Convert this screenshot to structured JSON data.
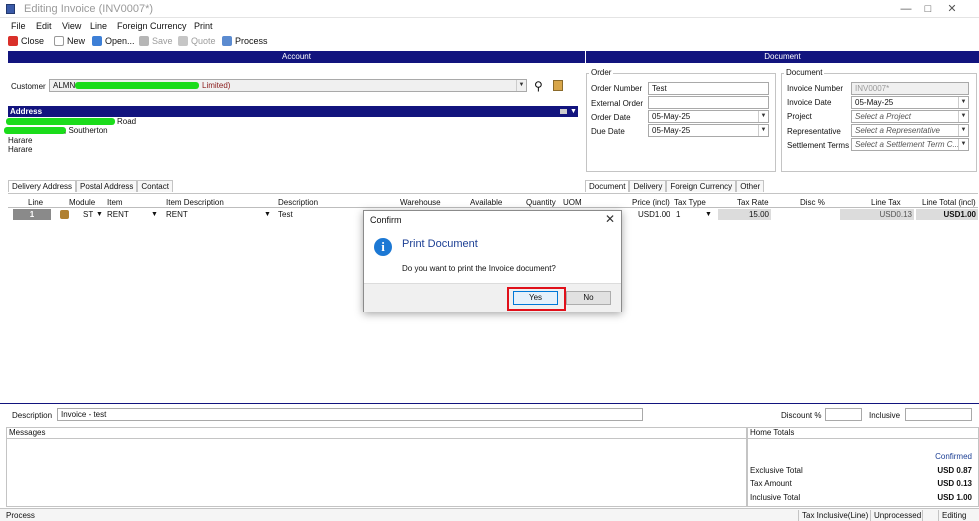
{
  "window": {
    "title": "Editing Invoice (INV0007*)"
  },
  "menu": [
    "File",
    "Edit",
    "View",
    "Line",
    "Foreign Currency",
    "Print"
  ],
  "toolbar": {
    "close": "Close",
    "new": "New",
    "open": "Open...",
    "save": "Save",
    "quote": "Quote",
    "process": "Process"
  },
  "sections": {
    "account": "Account",
    "document": "Document"
  },
  "customer": {
    "label": "Customer",
    "code": "ALMN",
    "name_suffix": "Limited)"
  },
  "address": {
    "title": "Address",
    "line1_suffix": "Road",
    "line2_suffix": ", Southerton",
    "line3": "Harare",
    "line4": "Harare"
  },
  "address_tabs": [
    "Delivery Address",
    "Postal Address",
    "Contact"
  ],
  "order": {
    "title": "Order",
    "order_number_label": "Order Number",
    "order_number": "Test",
    "external_order_label": "External Order",
    "external_order": "",
    "order_date_label": "Order Date",
    "order_date": "05-May-25",
    "due_date_label": "Due Date",
    "due_date": "05-May-25"
  },
  "document": {
    "title": "Document",
    "invoice_number_label": "Invoice Number",
    "invoice_number": "INV0007*",
    "invoice_date_label": "Invoice Date",
    "invoice_date": "05-May-25",
    "project_label": "Project",
    "project_placeholder": "Select a Project",
    "rep_label": "Representative",
    "rep_placeholder": "Select a Representative",
    "terms_label": "Settlement Terms",
    "terms_placeholder": "Select a Settlement Term C..."
  },
  "doc_tabs": [
    "Document",
    "Delivery",
    "Foreign Currency",
    "Other"
  ],
  "grid": {
    "headers": [
      "Line",
      "Module",
      "Item",
      "Item Description",
      "Description",
      "Warehouse",
      "Available",
      "Quantity",
      "UOM",
      "Price (incl)",
      "Tax Type",
      "Tax Rate",
      "Disc %",
      "Line Tax",
      "Line Total (incl)"
    ],
    "row": {
      "line": "1",
      "module": "ST",
      "item": "RENT",
      "item_description": "RENT",
      "description": "Test",
      "price": "USD1.00",
      "tax_type": "1",
      "tax_rate": "15.00",
      "line_tax": "USD0.13",
      "line_total": "USD1.00"
    }
  },
  "footer": {
    "description_label": "Description",
    "description": "Invoice - test",
    "discount_label": "Discount %",
    "inclusive_label": "Inclusive",
    "messages_label": "Messages",
    "home_totals_label": "Home Totals",
    "confirmed": "Confirmed",
    "exclusive_label": "Exclusive Total",
    "exclusive": "USD 0.87",
    "tax_label": "Tax Amount",
    "tax": "USD 0.13",
    "inclusive_total_label": "Inclusive Total",
    "inclusive_total": "USD 1.00"
  },
  "dialog": {
    "title": "Confirm",
    "heading": "Print Document",
    "message": "Do you want to print the Invoice document?",
    "yes": "Yes",
    "no": "No"
  },
  "status": {
    "left": "Process",
    "tax_mode": "Tax Inclusive(Line)",
    "state": "Unprocessed",
    "mode": "Editing"
  },
  "colors": {
    "header_bar": "#12147e",
    "highlight": "#e0101a",
    "info_icon": "#1c78d4"
  }
}
